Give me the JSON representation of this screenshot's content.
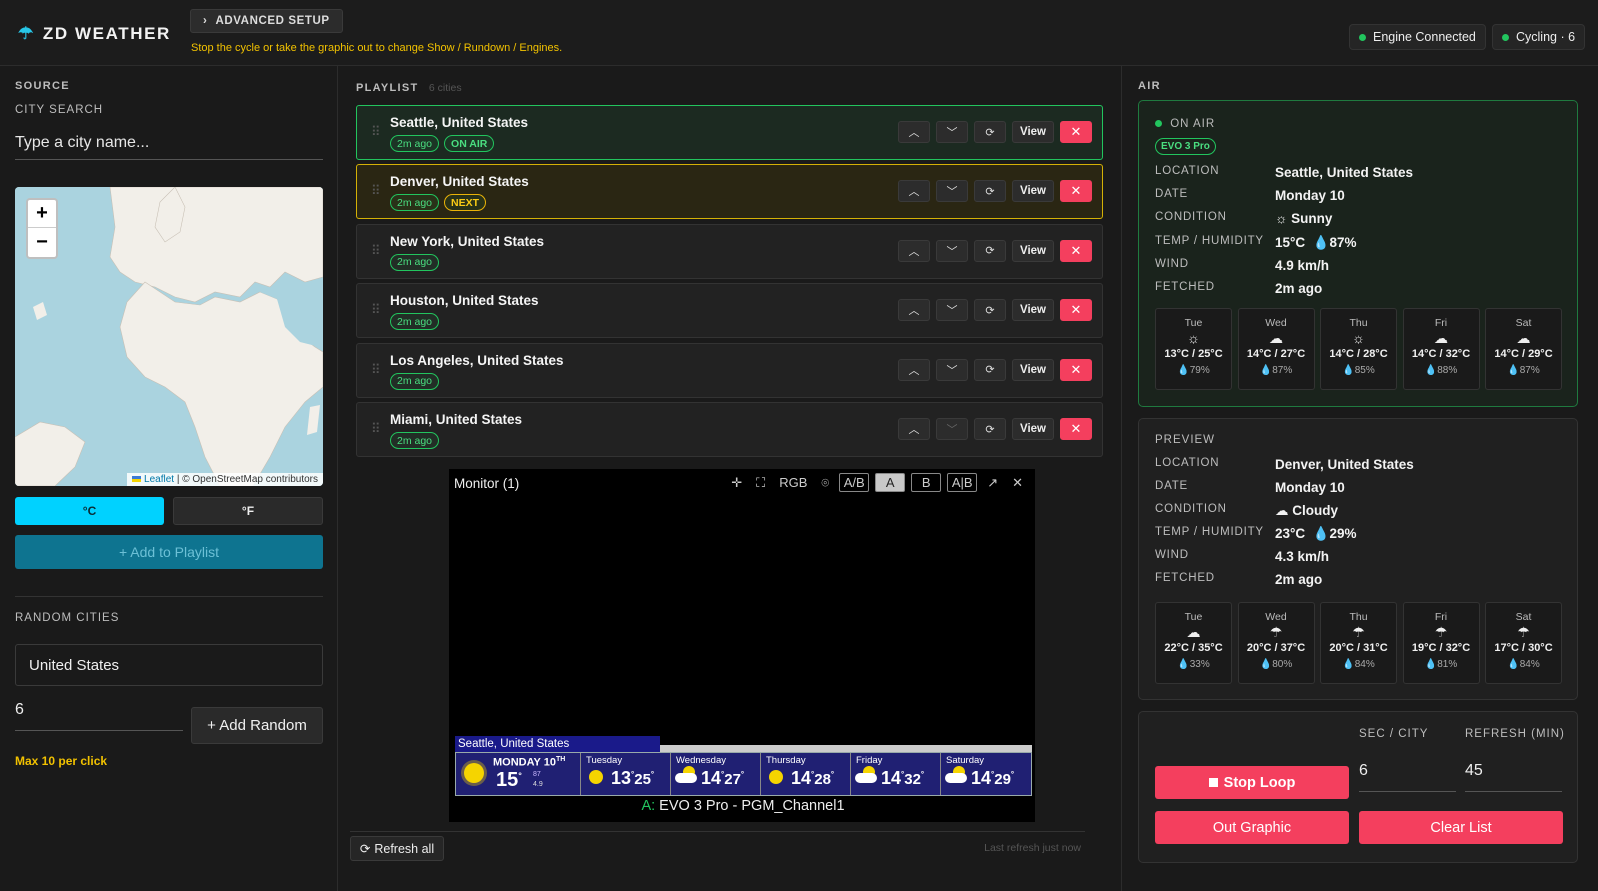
{
  "header": {
    "brand": "ZD WEATHER",
    "advanced_setup": "ADVANCED SETUP",
    "advanced_note": "Stop the cycle or take the graphic out to change Show / Rundown / Engines.",
    "engine_status": "Engine Connected",
    "cycling_status": "Cycling · 6",
    "status_color": "#22c55e"
  },
  "source": {
    "section_label": "SOURCE",
    "city_search_label": "CITY SEARCH",
    "city_search_placeholder": "Type a city name...",
    "map": {
      "zoom_in": "+",
      "zoom_out": "−",
      "attribution_link": "Leaflet",
      "attribution_text": "| © OpenStreetMap contributors"
    },
    "unit_c": "°C",
    "unit_f": "°F",
    "selected_unit": "°C",
    "add_to_playlist": "+ Add to Playlist",
    "random_label": "RANDOM CITIES",
    "random_country": "United States",
    "random_count": "6",
    "add_random": "+ Add Random",
    "max_note": "Max 10 per click"
  },
  "playlist": {
    "label": "PLAYLIST",
    "count": "6 cities",
    "view_label": "View",
    "items": [
      {
        "name": "Seattle, United States",
        "age": "2m ago",
        "status": "ON AIR"
      },
      {
        "name": "Denver, United States",
        "age": "2m ago",
        "status": "NEXT"
      },
      {
        "name": "New York, United States",
        "age": "2m ago",
        "status": ""
      },
      {
        "name": "Houston, United States",
        "age": "2m ago",
        "status": ""
      },
      {
        "name": "Los Angeles, United States",
        "age": "2m ago",
        "status": ""
      },
      {
        "name": "Miami, United States",
        "age": "2m ago",
        "status": ""
      }
    ],
    "refresh_all": "Refresh all",
    "last_refresh": "Last refresh just now"
  },
  "monitor": {
    "title": "Monitor (1)",
    "tools": {
      "rgb": "RGB",
      "ab1": "A/B",
      "a": "A",
      "b": "B",
      "ab2": "A|B"
    },
    "footer_prefix": "A:",
    "footer_channel": "EVO 3 Pro - PGM_Channel1",
    "ticker": {
      "city": "Seattle, United States",
      "today_day": "MONDAY 10",
      "today_suffix": "TH",
      "today_temp": "15",
      "today_humidity": "87",
      "today_wind": "4.9",
      "days": [
        {
          "day": "Tuesday",
          "low": "13",
          "high": "25",
          "icon": "sun"
        },
        {
          "day": "Wednesday",
          "low": "14",
          "high": "27",
          "icon": "partly-cloudy"
        },
        {
          "day": "Thursday",
          "low": "14",
          "high": "28",
          "icon": "sun"
        },
        {
          "day": "Friday",
          "low": "14",
          "high": "32",
          "icon": "partly-cloudy"
        },
        {
          "day": "Saturday",
          "low": "14",
          "high": "29",
          "icon": "partly-cloudy"
        }
      ]
    }
  },
  "air": {
    "section_label": "AIR",
    "status": "ON AIR",
    "engine_badge": "EVO 3 Pro",
    "labels": {
      "location": "LOCATION",
      "date": "DATE",
      "condition": "CONDITION",
      "temp_humidity": "TEMP / HUMIDITY",
      "wind": "WIND",
      "fetched": "FETCHED"
    },
    "location": "Seattle, United States",
    "date": "Monday 10",
    "condition": "Sunny",
    "condition_icon": "sun-icon",
    "temp": "15°C",
    "humidity": "87%",
    "wind": "4.9 km/h",
    "fetched": "2m ago",
    "forecast": [
      {
        "day": "Tue",
        "icon": "sun",
        "temps": "13°C / 25°C",
        "humidity": "79%"
      },
      {
        "day": "Wed",
        "icon": "cloud",
        "temps": "14°C / 27°C",
        "humidity": "87%"
      },
      {
        "day": "Thu",
        "icon": "sun",
        "temps": "14°C / 28°C",
        "humidity": "85%"
      },
      {
        "day": "Fri",
        "icon": "cloud",
        "temps": "14°C / 32°C",
        "humidity": "88%"
      },
      {
        "day": "Sat",
        "icon": "cloud",
        "temps": "14°C / 29°C",
        "humidity": "87%"
      }
    ]
  },
  "preview": {
    "section_label": "PREVIEW",
    "location": "Denver, United States",
    "date": "Monday 10",
    "condition": "Cloudy",
    "condition_icon": "cloud-icon",
    "temp": "23°C",
    "humidity": "29%",
    "wind": "4.3 km/h",
    "fetched": "2m ago",
    "forecast": [
      {
        "day": "Tue",
        "icon": "cloud",
        "temps": "22°C / 35°C",
        "humidity": "33%"
      },
      {
        "day": "Wed",
        "icon": "rain",
        "temps": "20°C / 37°C",
        "humidity": "80%"
      },
      {
        "day": "Thu",
        "icon": "rain",
        "temps": "20°C / 31°C",
        "humidity": "84%"
      },
      {
        "day": "Fri",
        "icon": "rain",
        "temps": "19°C / 32°C",
        "humidity": "81%"
      },
      {
        "day": "Sat",
        "icon": "rain",
        "temps": "17°C / 30°C",
        "humidity": "84%"
      }
    ]
  },
  "controls": {
    "sec_city_label": "SEC / CITY",
    "refresh_label": "REFRESH (MIN)",
    "sec_city": "6",
    "refresh_min": "45",
    "stop_loop": "Stop Loop",
    "out_graphic": "Out Graphic",
    "clear_list": "Clear List",
    "accent": "#f43f5e"
  }
}
